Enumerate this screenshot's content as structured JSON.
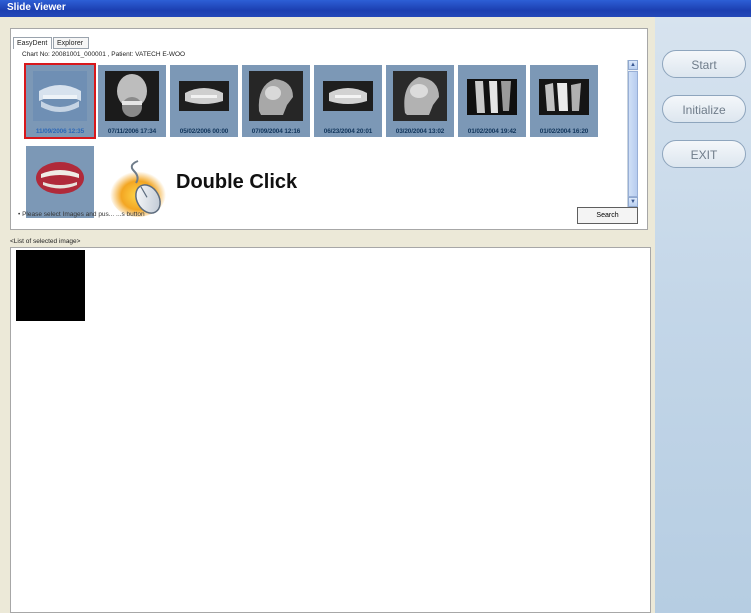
{
  "window": {
    "title": "Slide Viewer"
  },
  "tabs": [
    {
      "label": "EasyDent"
    },
    {
      "label": "Explorer"
    }
  ],
  "chart_info": "Chart No: 20081001_000001 , Patient: VATECH E-WOO",
  "thumbnails": [
    {
      "date": "11/09/2006 12:35",
      "type": "dental-cast",
      "selected": true
    },
    {
      "date": "07/11/2006 17:34",
      "type": "pa-ceph"
    },
    {
      "date": "05/02/2006 00:00",
      "type": "panoramic"
    },
    {
      "date": "07/09/2004 12:16",
      "type": "ceph"
    },
    {
      "date": "06/23/2004 20:01",
      "type": "panoramic"
    },
    {
      "date": "03/20/2004 13:02",
      "type": "ceph"
    },
    {
      "date": "01/02/2004 19:42",
      "type": "periapical"
    },
    {
      "date": "01/02/2004 16:20",
      "type": "periapical"
    },
    {
      "date": "",
      "type": "intraoral-photo"
    }
  ],
  "overlay": {
    "text": "Double Click",
    "icon": "mouse-icon"
  },
  "hint": "• Please select Images and pus...   ...s button",
  "search_button": "Search",
  "list_label": "<List of selected image>",
  "side_buttons": {
    "start": "Start",
    "initialize": "Initialize",
    "exit": "EXIT"
  },
  "colors": {
    "titlebar": "#1c3fb1",
    "thumb_bg": "#7c98b6",
    "selection": "#d8181c",
    "side_panel": "#c3d6e8"
  }
}
